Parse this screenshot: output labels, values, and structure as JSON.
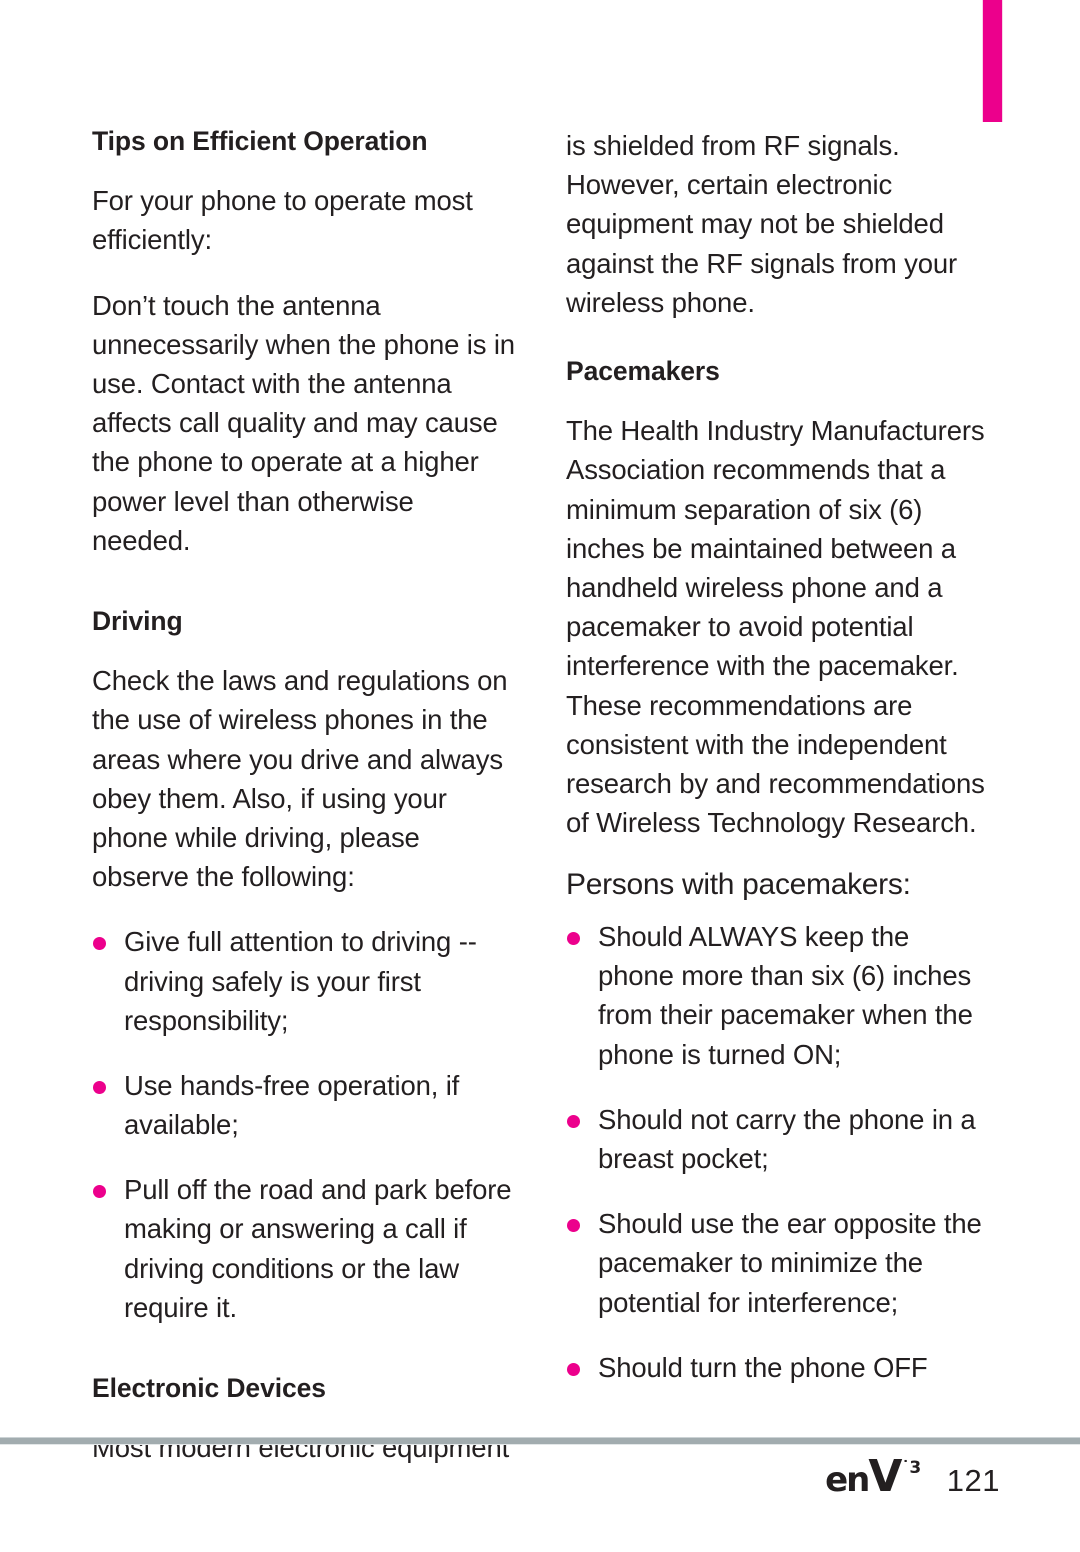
{
  "theme": {
    "accent_pink": "#ec008c",
    "text_color": "#231f20",
    "rule_color": "#a2acaf"
  },
  "left_column": {
    "heading_1": "Tips on Efficient Operation",
    "paragraph_1": "For your phone to operate most efficiently:",
    "paragraph_2": "Don’t touch the antenna unnecessarily when the phone is in use. Contact with the antenna affects call quality and may cause the phone to operate at a higher power level than otherwise needed.",
    "heading_2": "Driving",
    "paragraph_3": "Check the laws and regulations on the use of wireless phones in the areas where you drive and always obey them. Also, if using your phone while driving, please observe the following:",
    "bullets": [
      "Give full attention to driving -- driving safely is your first responsibility;",
      "Use hands-free operation, if available;",
      "Pull off the road and park before making or answering a call if driving conditions or the law require it."
    ],
    "heading_3": "Electronic Devices",
    "paragraph_4": "Most modern electronic equipment"
  },
  "right_column": {
    "paragraph_1": "is shielded from RF signals. However, certain electronic equipment may not be shielded against the RF signals from your wireless phone.",
    "heading_1": "Pacemakers",
    "paragraph_2": "The Health Industry Manufacturers Association recommends that a minimum separation of six (6) inches be maintained between a handheld wireless phone and a pacemaker to avoid potential interference with the pacemaker. These recommendations are consistent with the independent research by and recommendations of Wireless Technology Research.",
    "subheading_1": "Persons with pacemakers:",
    "bullets": [
      "Should ALWAYS keep the phone more than six (6) inches from their pacemaker when the phone is turned ON;",
      "Should not carry the phone in a breast pocket;",
      "Should use the ear opposite the pacemaker to minimize the potential for interference;",
      "Should turn the phone OFF"
    ]
  },
  "footer": {
    "logo_en": "en",
    "logo_v": "V",
    "logo_superscript": "˙3",
    "page_number": "121"
  }
}
